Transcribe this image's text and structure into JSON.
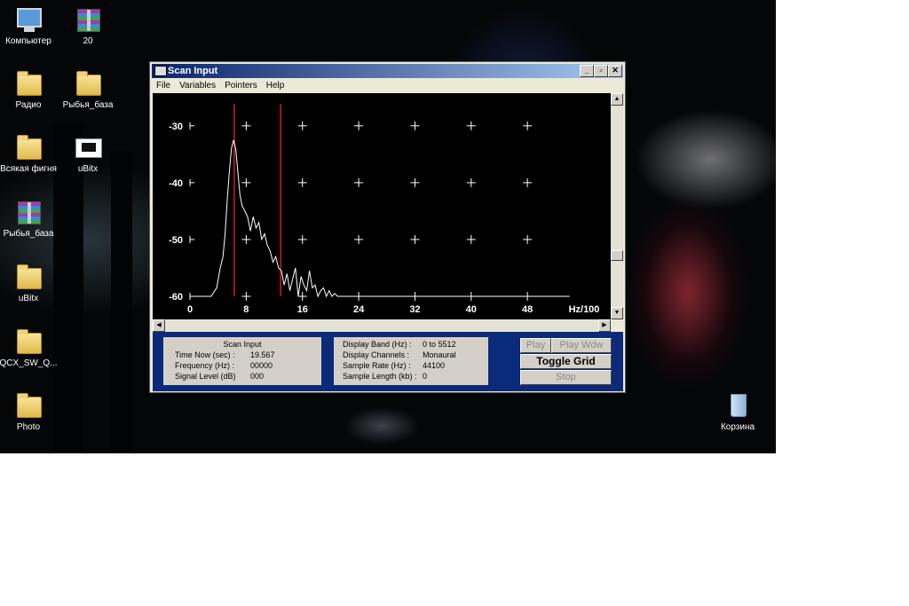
{
  "desktop": {
    "icons": [
      {
        "label": "Компьютер",
        "icon": "my-computer-icon"
      },
      {
        "label": "20",
        "icon": "winrar-archive-icon"
      },
      {
        "label": "Радио",
        "icon": "folder-icon"
      },
      {
        "label": "Рыбья_база",
        "icon": "folder-icon"
      },
      {
        "label": "Всякая фигня",
        "icon": "folder-shortcut-icon"
      },
      {
        "label": "uBitx",
        "icon": "program-icon"
      },
      {
        "label": "Рыбья_база",
        "icon": "winrar-archive-icon"
      },
      {
        "label": "uBitx",
        "icon": "folder-icon"
      },
      {
        "label": "QCX_SW_Q...",
        "icon": "folder-icon"
      },
      {
        "label": "Photo",
        "icon": "folder-icon"
      },
      {
        "label": "Корзина",
        "icon": "recycle-bin-icon"
      }
    ]
  },
  "window": {
    "title": "Scan Input",
    "controls": {
      "minimize": "_",
      "maximize": "▫",
      "close": "✕"
    },
    "menu": [
      "File",
      "Variables",
      "Pointers",
      "Help"
    ]
  },
  "chart_data": {
    "type": "line",
    "x_unit_label": "Hz/100",
    "x_ticks": [
      "0",
      "8",
      "16",
      "24",
      "32",
      "40",
      "48"
    ],
    "y_ticks": [
      "-30",
      "-40",
      "-50",
      "-60"
    ],
    "xlim": [
      0,
      54
    ],
    "ylim": [
      -60,
      -28
    ],
    "grid": true,
    "cursor_lines_x": [
      6.3,
      12.9
    ],
    "series": [
      {
        "x": [
          0,
          3.0,
          3.8,
          4.3,
          4.7,
          5.0,
          5.3,
          5.6,
          5.9,
          6.2,
          6.5,
          6.8,
          7.1,
          7.4,
          7.8,
          8.2,
          8.6,
          9.0,
          9.4,
          9.8,
          10.2,
          10.6,
          11.0,
          11.4,
          11.8,
          12.2,
          12.6,
          13.0,
          13.4,
          13.8,
          14.2,
          14.6,
          15.0,
          15.4,
          15.8,
          16.2,
          16.6,
          17.0,
          17.4,
          17.8,
          18.2,
          18.6,
          19.0,
          19.4,
          19.8,
          20.2,
          20.6,
          21.0,
          54
        ],
        "y": [
          -60,
          -60,
          -58.5,
          -55,
          -53,
          -49,
          -43,
          -38,
          -34,
          -32.5,
          -34,
          -38,
          -42,
          -44,
          -45,
          -46,
          -48.5,
          -46,
          -48,
          -47,
          -50,
          -49,
          -51,
          -52,
          -54,
          -53,
          -55,
          -55.5,
          -58,
          -56,
          -59,
          -57,
          -55,
          -60,
          -56.5,
          -58,
          -59,
          -55.5,
          -58.5,
          -58,
          -60,
          -59,
          -58.5,
          -60,
          -59,
          -60,
          -59.5,
          -60,
          -60
        ]
      }
    ]
  },
  "status_box": {
    "title": "Scan Input",
    "rows": [
      {
        "label": "Time Now (sec) :",
        "value": "19.567"
      },
      {
        "label": "Frequency (Hz) :",
        "value": "00000"
      },
      {
        "label": "Signal Level (dB)",
        "value": "000"
      }
    ]
  },
  "info_box": {
    "rows": [
      {
        "label": "Display Band (Hz) :",
        "value": "0 to 5512"
      },
      {
        "label": "Display Channels :",
        "value": "Monaural"
      },
      {
        "label": "Sample Rate (Hz) :",
        "value": "44100"
      },
      {
        "label": "Sample Length (kb) :",
        "value": "0"
      }
    ]
  },
  "buttons": {
    "play": "Play",
    "play_wdw": "Play Wdw",
    "toggle_grid": "Toggle Grid",
    "stop": "Stop"
  },
  "colors": {
    "plot_bg": "#000000",
    "trace": "#ffffff",
    "cursor": "#a01818",
    "panel_bg": "#0b2a7a"
  }
}
